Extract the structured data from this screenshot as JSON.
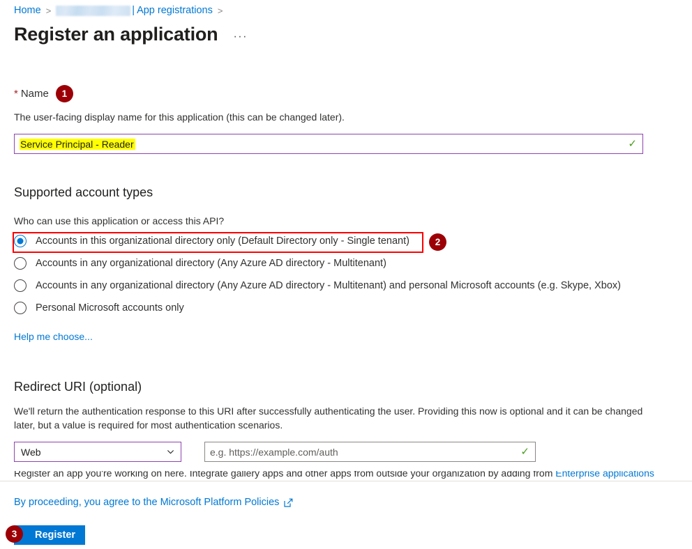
{
  "breadcrumb": {
    "home": "Home",
    "redacted_tenant": "",
    "pipe": "|",
    "app_registrations": "App registrations",
    "separator": ">"
  },
  "header": {
    "title": "Register an application",
    "more_options": "···"
  },
  "name_section": {
    "required_marker": "*",
    "label": "Name",
    "badge": "1",
    "helper": "The user-facing display name for this application (this can be changed later).",
    "value": "Service Principal - Reader",
    "valid_icon": "✓"
  },
  "account_types": {
    "heading": "Supported account types",
    "question": "Who can use this application or access this API?",
    "badge": "2",
    "options": [
      {
        "label": "Accounts in this organizational directory only (Default Directory only - Single tenant)",
        "selected": true
      },
      {
        "label": "Accounts in any organizational directory (Any Azure AD directory - Multitenant)",
        "selected": false
      },
      {
        "label": "Accounts in any organizational directory (Any Azure AD directory - Multitenant) and personal Microsoft accounts (e.g. Skype, Xbox)",
        "selected": false
      },
      {
        "label": "Personal Microsoft accounts only",
        "selected": false
      }
    ],
    "help_link": "Help me choose..."
  },
  "redirect_uri": {
    "heading": "Redirect URI (optional)",
    "description": "We'll return the authentication response to this URI after successfully authenticating the user. Providing this now is optional and it can be changed later, but a value is required for most authentication scenarios.",
    "platform_value": "Web",
    "uri_placeholder": "e.g. https://example.com/auth",
    "valid_icon": "✓"
  },
  "note": {
    "text": "Register an app you're working on here. Integrate gallery apps and other apps from outside your organization by adding from ",
    "link": "Enterprise applications"
  },
  "footer": {
    "policy_text": "By proceeding, you agree to the Microsoft Platform Policies",
    "register_label": "Register",
    "register_badge": "3"
  },
  "colors": {
    "accent": "#0078d4",
    "badge": "#9c0006",
    "annotation": "#ff0000",
    "focus_border": "#8e44ad",
    "highlight": "#ffff00",
    "valid": "#4a9c1e"
  }
}
